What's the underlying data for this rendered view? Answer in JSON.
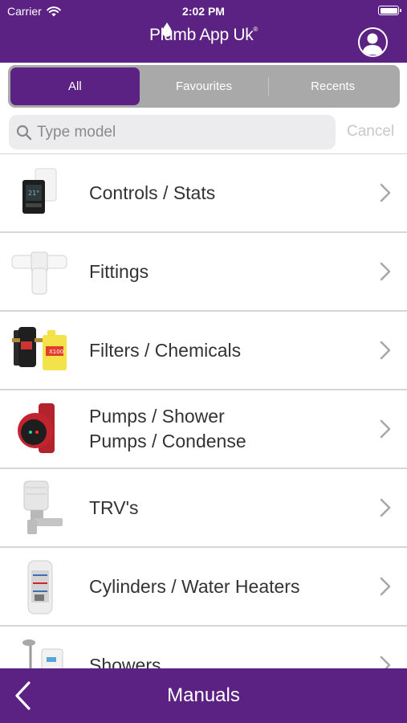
{
  "status": {
    "carrier": "Carrier",
    "time": "2:02 PM"
  },
  "header": {
    "logo_text": "Plumb App Uk",
    "logo_mark": "®"
  },
  "tabs": [
    {
      "label": "All",
      "active": true
    },
    {
      "label": "Favourites",
      "active": false
    },
    {
      "label": "Recents",
      "active": false
    }
  ],
  "search": {
    "placeholder": "Type model",
    "cancel": "Cancel"
  },
  "categories": [
    {
      "label": "Controls / Stats",
      "icon": "thermostat-image"
    },
    {
      "label": "Fittings",
      "icon": "pipe-fitting-image"
    },
    {
      "label": "Filters / Chemicals",
      "icon": "filter-chemical-image"
    },
    {
      "label": "Pumps / Shower\nPumps / Condense",
      "icon": "pump-image"
    },
    {
      "label": "TRV's",
      "icon": "trv-valve-image"
    },
    {
      "label": "Cylinders / Water Heaters",
      "icon": "cylinder-image"
    },
    {
      "label": "Showers",
      "icon": "shower-image"
    }
  ],
  "footer": {
    "title": "Manuals"
  },
  "colors": {
    "brand": "#5b2283",
    "segment_bg": "#a9a9a9",
    "text": "#333333",
    "cancel": "#c8c8cc"
  }
}
